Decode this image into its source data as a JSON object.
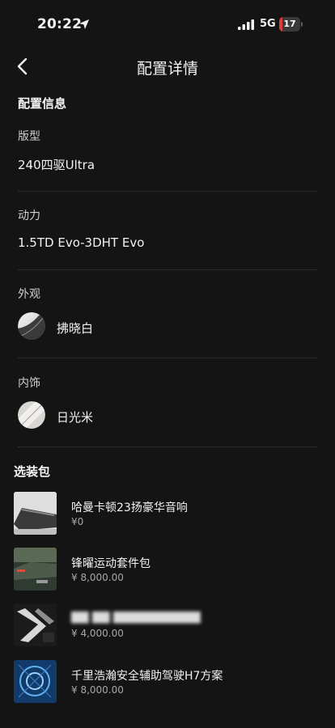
{
  "status_bar": {
    "time": "20:22",
    "network": "5G",
    "battery": "17",
    "battery_level_percent": 17,
    "battery_color": "#e03a3a"
  },
  "nav": {
    "title": "配置详情"
  },
  "config": {
    "heading": "配置信息",
    "trim_label": "版型",
    "trim_value": "240四驱Ultra",
    "power_label": "动力",
    "power_value": "1.5TD Evo-3DHT Evo",
    "exterior_label": "外观",
    "exterior_value": "拂晓白",
    "interior_label": "内饰",
    "interior_value": "日光米"
  },
  "packages": {
    "heading": "选装包",
    "items": [
      {
        "name": "哈曼卡顿23扬豪华音响",
        "price": "¥0"
      },
      {
        "name": "锋曜运动套件包",
        "price": "¥ 8,000.00"
      },
      {
        "name": "",
        "price": "¥ 4,000.00"
      },
      {
        "name": "千里浩瀚安全辅助驾驶H7方案",
        "price": "¥ 8,000.00"
      }
    ]
  }
}
